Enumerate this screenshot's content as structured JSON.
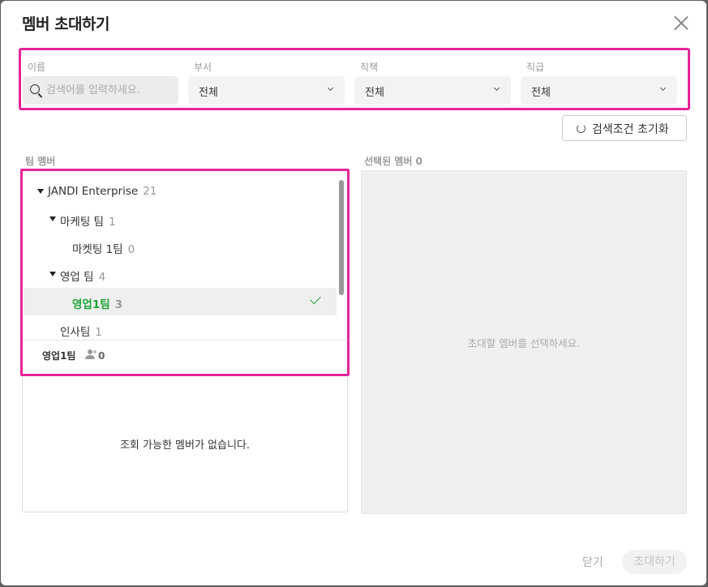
{
  "dialog": {
    "title": "멤버 초대하기"
  },
  "filters": {
    "name_label": "이름",
    "search_placeholder": "검색어를 입력하세요.",
    "department_label": "부서",
    "department_value": "전체",
    "duty_label": "직책",
    "duty_value": "전체",
    "rank_label": "직급",
    "rank_value": "전체",
    "reset_label": "검색조건 초기화"
  },
  "team": {
    "label": "팀 멤버",
    "tree": [
      {
        "name": "JANDI Enterprise",
        "count": "21",
        "expanded": true
      },
      {
        "name": "마케팅 팀",
        "count": "1",
        "expanded": true
      },
      {
        "name": "마켓팅 1팀",
        "count": "0"
      },
      {
        "name": "영업 팀",
        "count": "4",
        "expanded": true
      },
      {
        "name": "영업1팀",
        "count": "3",
        "selected": true
      },
      {
        "name": "인사팀",
        "count": "1"
      }
    ],
    "selected_team": "영업1팀",
    "selected_member_count": "0",
    "empty_message": "조회 가능한 멤버가 없습니다."
  },
  "selected": {
    "label": "선택된 멤버 0",
    "empty_message": "초대할 멤버를 선택하세요."
  },
  "footer": {
    "close_label": "닫기",
    "invite_label": "초대하기"
  },
  "colors": {
    "highlight": "#e6249a",
    "selected_green": "#1fa33b"
  }
}
